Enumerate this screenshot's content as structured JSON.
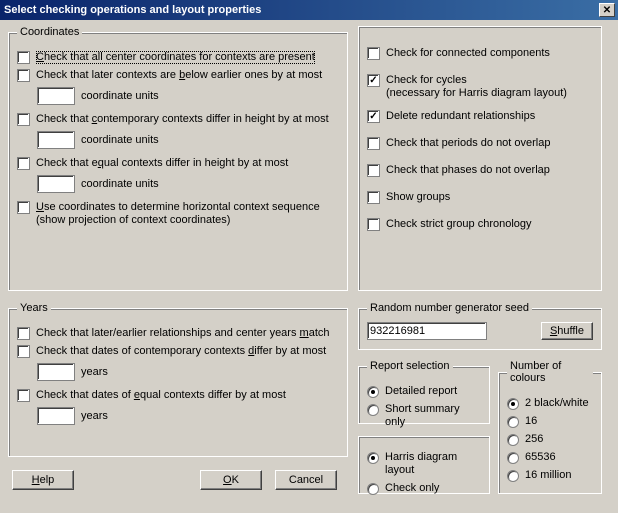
{
  "title": "Select checking operations and layout properties",
  "coordinates": {
    "legend": "Coordinates",
    "cb1": "Check that all center coordinates for contexts are present",
    "cb2": "Check that later contexts are below earlier ones by at most",
    "cb2_unit": "coordinate units",
    "cb3": "Check that contemporary contexts differ in height by at most",
    "cb3_unit": "coordinate units",
    "cb4": "Check that equal contexts differ in height by at most",
    "cb4_unit": "coordinate units",
    "cb5a": "Use coordinates to determine horizontal context sequence",
    "cb5b": "(show projection of context coordinates)"
  },
  "years": {
    "legend": "Years",
    "cb1": "Check that later/earlier relationships and center years match",
    "cb2": "Check that dates of contemporary contexts differ by at most",
    "cb2_unit": "years",
    "cb3": "Check that dates of equal contexts differ by at most",
    "cb3_unit": "years"
  },
  "right": {
    "cb1": "Check for connected components",
    "cb2a": "Check for cycles",
    "cb2b": "(necessary for Harris diagram layout)",
    "cb3": "Delete redundant relationships",
    "cb4": "Check that periods do not overlap",
    "cb5": "Check that phases do not overlap",
    "cb6": "Show groups",
    "cb7": "Check strict group chronology"
  },
  "seed": {
    "legend": "Random number generator seed",
    "value": "932216981",
    "shuffle": "Shuffle"
  },
  "report": {
    "legend": "Report selection",
    "r1": "Detailed report",
    "r2": "Short summary only",
    "r3": "Harris diagram layout",
    "r4": "Check only"
  },
  "colours": {
    "legend": "Number of colours",
    "r1": "2 black/white",
    "r2": "16",
    "r3": "256",
    "r4": "65536",
    "r5": "16 million"
  },
  "buttons": {
    "help": "Help",
    "ok": "OK",
    "cancel": "Cancel"
  }
}
